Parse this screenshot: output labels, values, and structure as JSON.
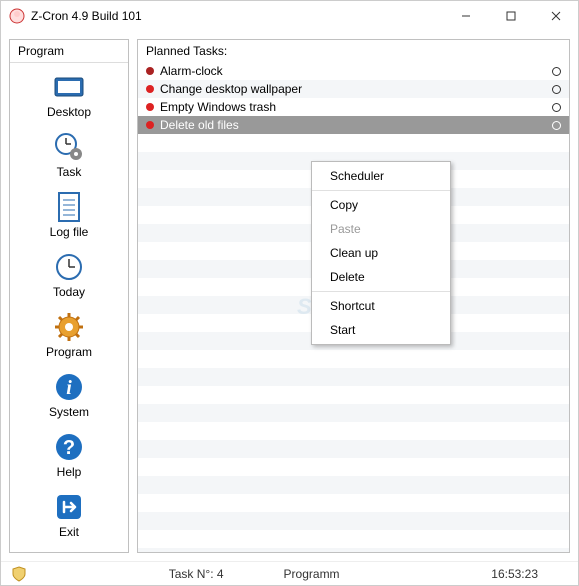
{
  "window": {
    "title": "Z-Cron 4.9 Build 101"
  },
  "sidebar": {
    "header": "Program",
    "items": [
      {
        "label": "Desktop"
      },
      {
        "label": "Task"
      },
      {
        "label": "Log file"
      },
      {
        "label": "Today"
      },
      {
        "label": "Program"
      },
      {
        "label": "System"
      },
      {
        "label": "Help"
      },
      {
        "label": "Exit"
      }
    ]
  },
  "main": {
    "header": "Planned Tasks:",
    "tasks": [
      {
        "label": "Alarm-clock",
        "bullet": "darkred",
        "selected": false
      },
      {
        "label": "Change desktop wallpaper",
        "bullet": "red",
        "selected": false
      },
      {
        "label": "Empty Windows trash",
        "bullet": "red",
        "selected": false
      },
      {
        "label": "Delete old files",
        "bullet": "red",
        "selected": true
      }
    ]
  },
  "context_menu": [
    {
      "label": "Scheduler",
      "enabled": true
    },
    {
      "sep": true
    },
    {
      "label": "Copy",
      "enabled": true
    },
    {
      "label": "Paste",
      "enabled": false
    },
    {
      "label": "Clean up",
      "enabled": true
    },
    {
      "label": "Delete",
      "enabled": true
    },
    {
      "sep": true
    },
    {
      "label": "Shortcut",
      "enabled": true
    },
    {
      "label": "Start",
      "enabled": true
    }
  ],
  "status": {
    "task_count": "Task N°: 4",
    "prog": "Programm",
    "time": "16:53:23"
  },
  "watermark": "SnapFiles"
}
